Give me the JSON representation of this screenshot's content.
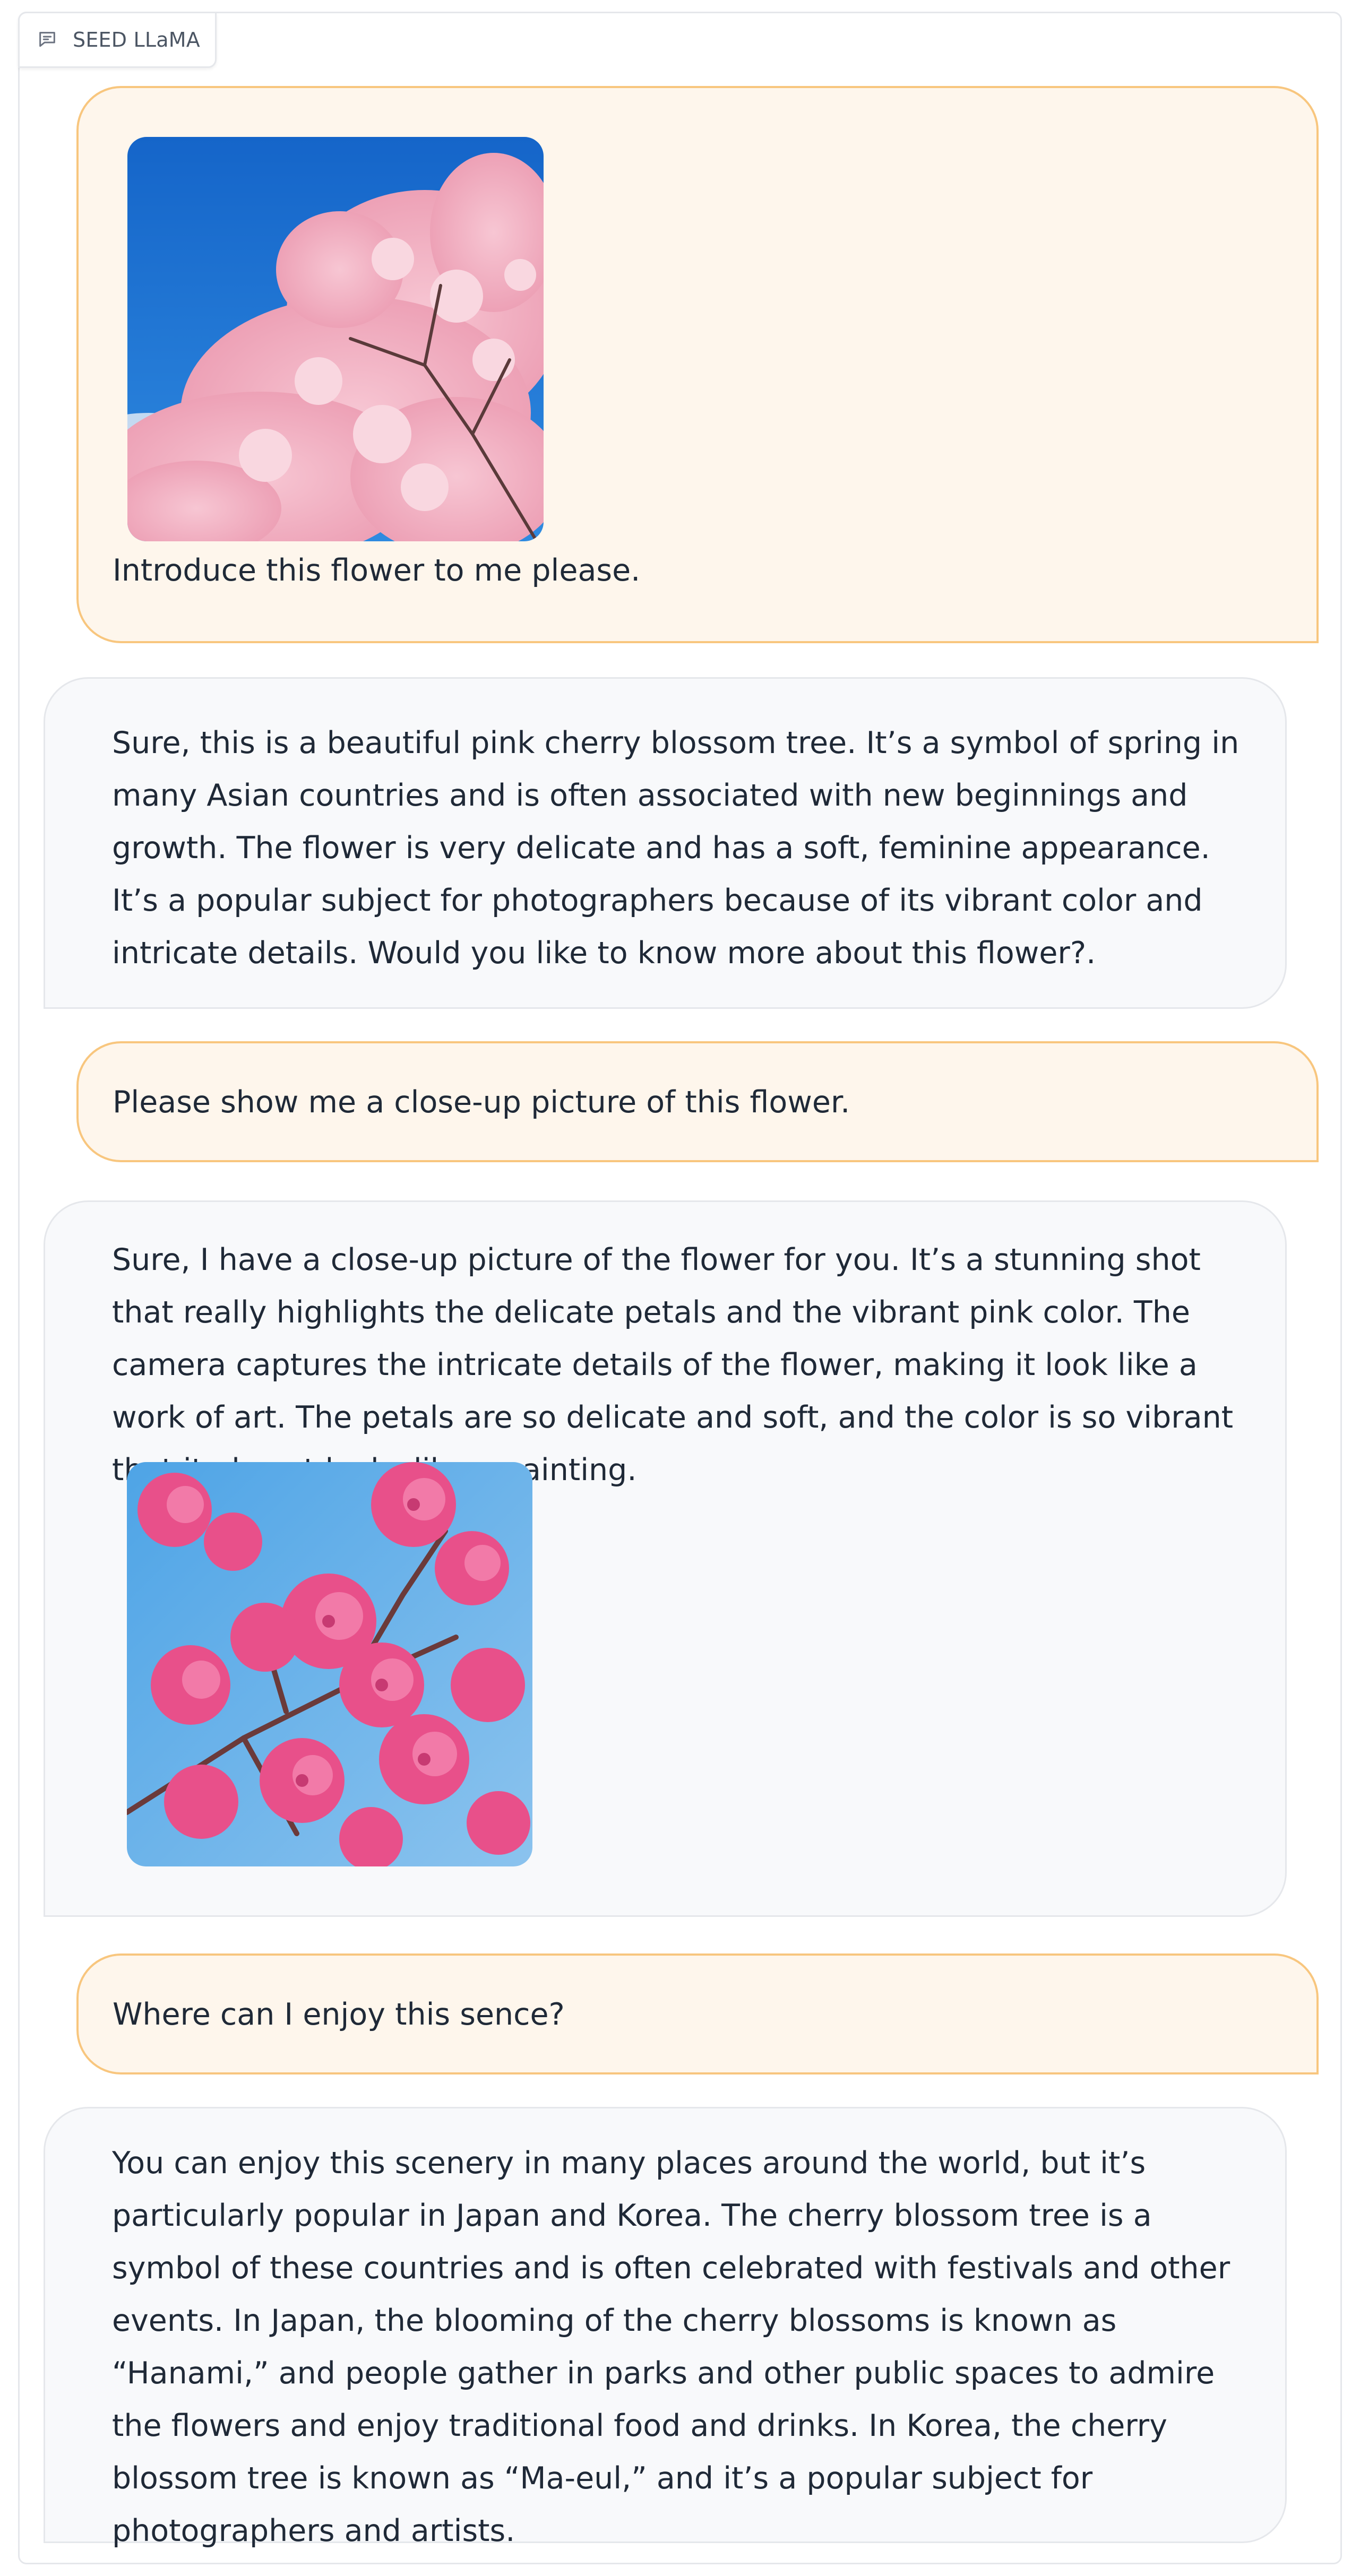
{
  "panel": {
    "label": "SEED LLaMA",
    "icon": "chat-bubble-icon"
  },
  "colors": {
    "user_bubble_bg": "#fef6ec",
    "user_bubble_border": "#f8c67e",
    "bot_bubble_bg": "#f8f9fb",
    "bot_bubble_border": "#e5e7eb"
  },
  "messages": [
    {
      "role": "user",
      "image": "cherry-blossom-tree-photo",
      "text": "Introduce this flower to me please."
    },
    {
      "role": "bot",
      "text": "Sure, this is a beautiful pink cherry blossom tree. It’s a symbol of spring in many Asian countries and is often associated with new beginnings and growth. The flower is very delicate and has a soft, feminine appearance. It’s a popular subject for photographers because of its vibrant color and intricate details. Would you like to know more about this flower?."
    },
    {
      "role": "user",
      "text": "Please show me a close-up picture of this flower."
    },
    {
      "role": "bot",
      "text": "Sure, I have a close-up picture of the flower for you. It’s a stunning shot that really highlights the delicate petals and the vibrant pink color. The camera captures the intricate details of the flower, making it look like a work of art. The petals are so delicate and soft, and the color is so vibrant that it almost looks like a painting.",
      "image": "cherry-blossom-closeup-photo"
    },
    {
      "role": "user",
      "text": "Where can I enjoy this sence?"
    },
    {
      "role": "bot",
      "text": "You can enjoy this scenery in many places around the world, but it’s particularly popular in Japan and Korea. The cherry blossom tree is a symbol of these countries and is often celebrated with festivals and other events. In Japan, the blooming of the cherry blossoms is known as “Hanami,” and people gather in parks and other public spaces to admire the flowers and enjoy traditional food and drinks. In Korea, the cherry blossom tree is known as “Ma-eul,” and it’s a popular subject for photographers and artists."
    }
  ]
}
